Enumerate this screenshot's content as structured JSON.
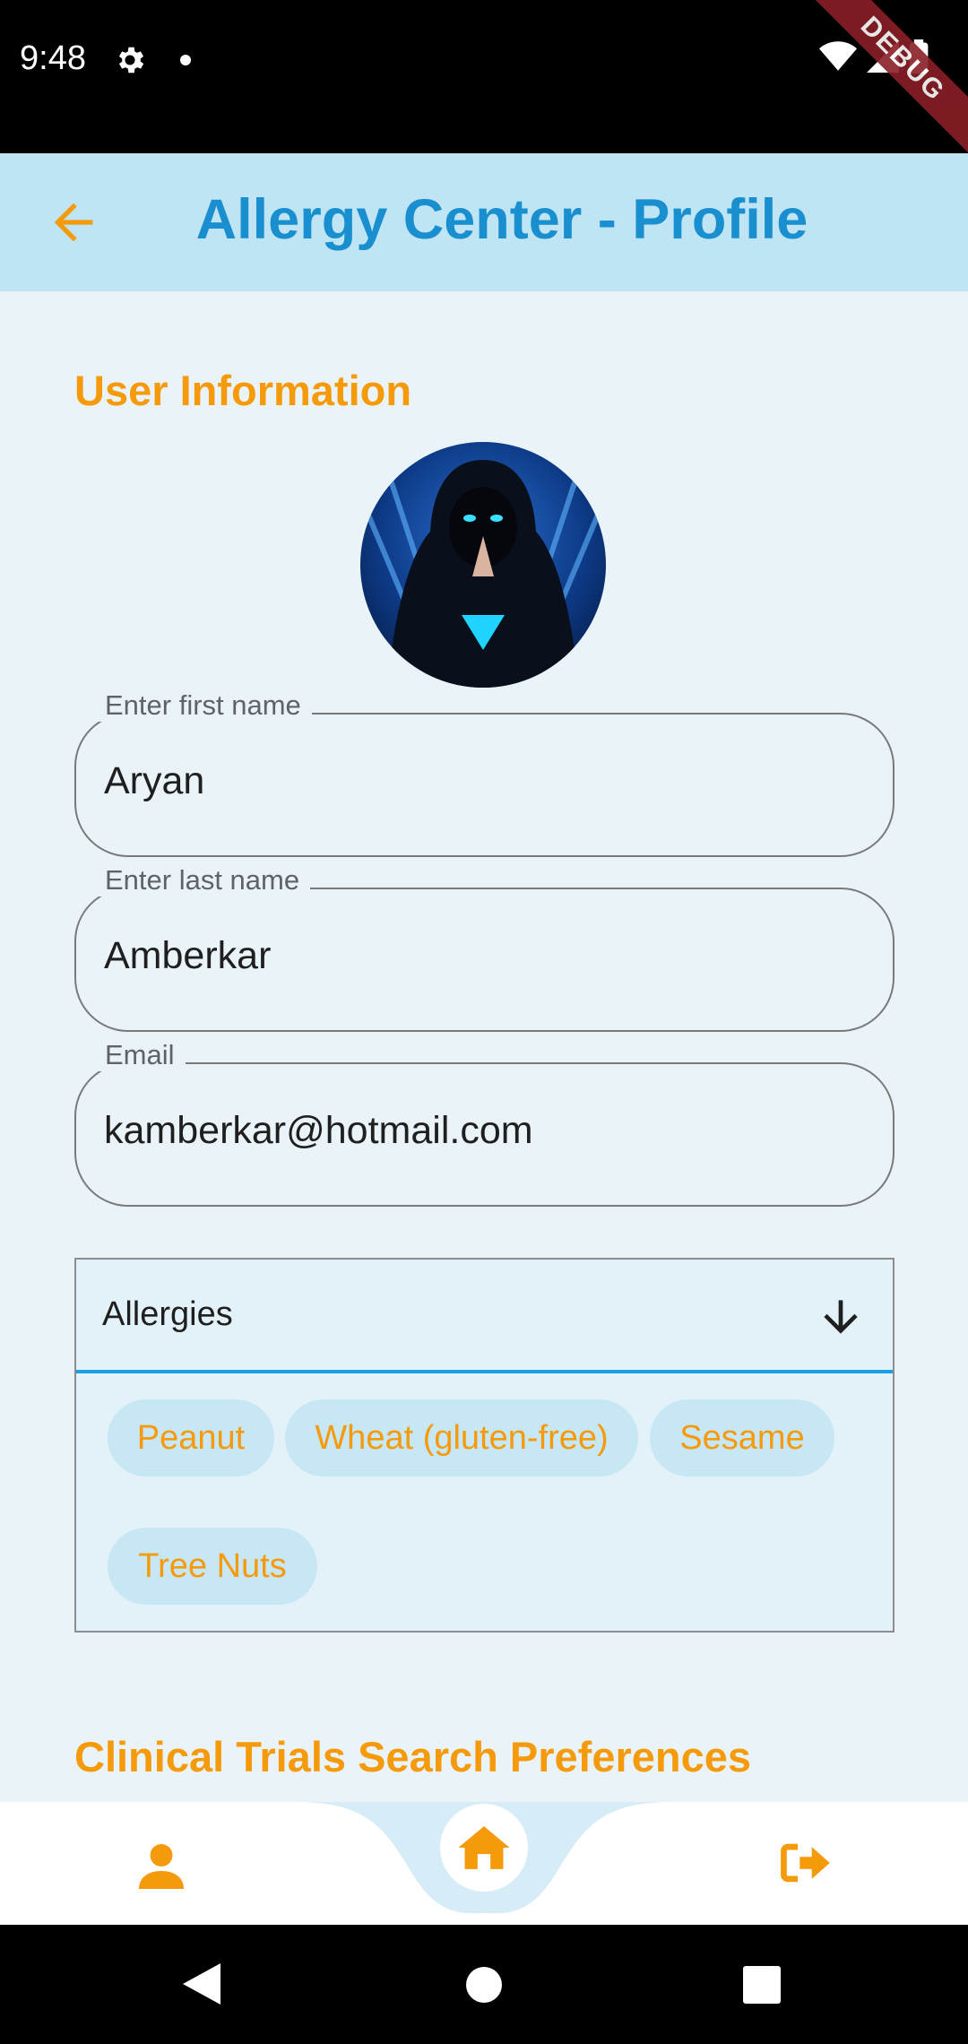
{
  "status": {
    "time": "9:48",
    "debug": "DEBUG"
  },
  "app_bar": {
    "title": "Allergy Center - Profile"
  },
  "user_info": {
    "section_title": "User Information",
    "first_name": {
      "label": "Enter first name",
      "value": "Aryan"
    },
    "last_name": {
      "label": "Enter last name",
      "value": "Amberkar"
    },
    "email": {
      "label": "Email",
      "value": "kamberkar@hotmail.com"
    }
  },
  "allergies": {
    "title": "Allergies",
    "chips": [
      "Peanut",
      "Wheat (gluten-free)",
      "Sesame",
      "Tree Nuts"
    ]
  },
  "clinical": {
    "section_title": "Clinical Trials Search Preferences"
  },
  "colors": {
    "accent": "#f59a0b",
    "title_blue": "#1a8fcf",
    "app_bar": "#bfe5f5",
    "background": "#eaf4f8"
  },
  "icons": {
    "back": "arrow-left-icon",
    "dropdown": "arrow-down-icon",
    "profile": "person-icon",
    "home": "home-icon",
    "logout": "sign-out-icon"
  }
}
